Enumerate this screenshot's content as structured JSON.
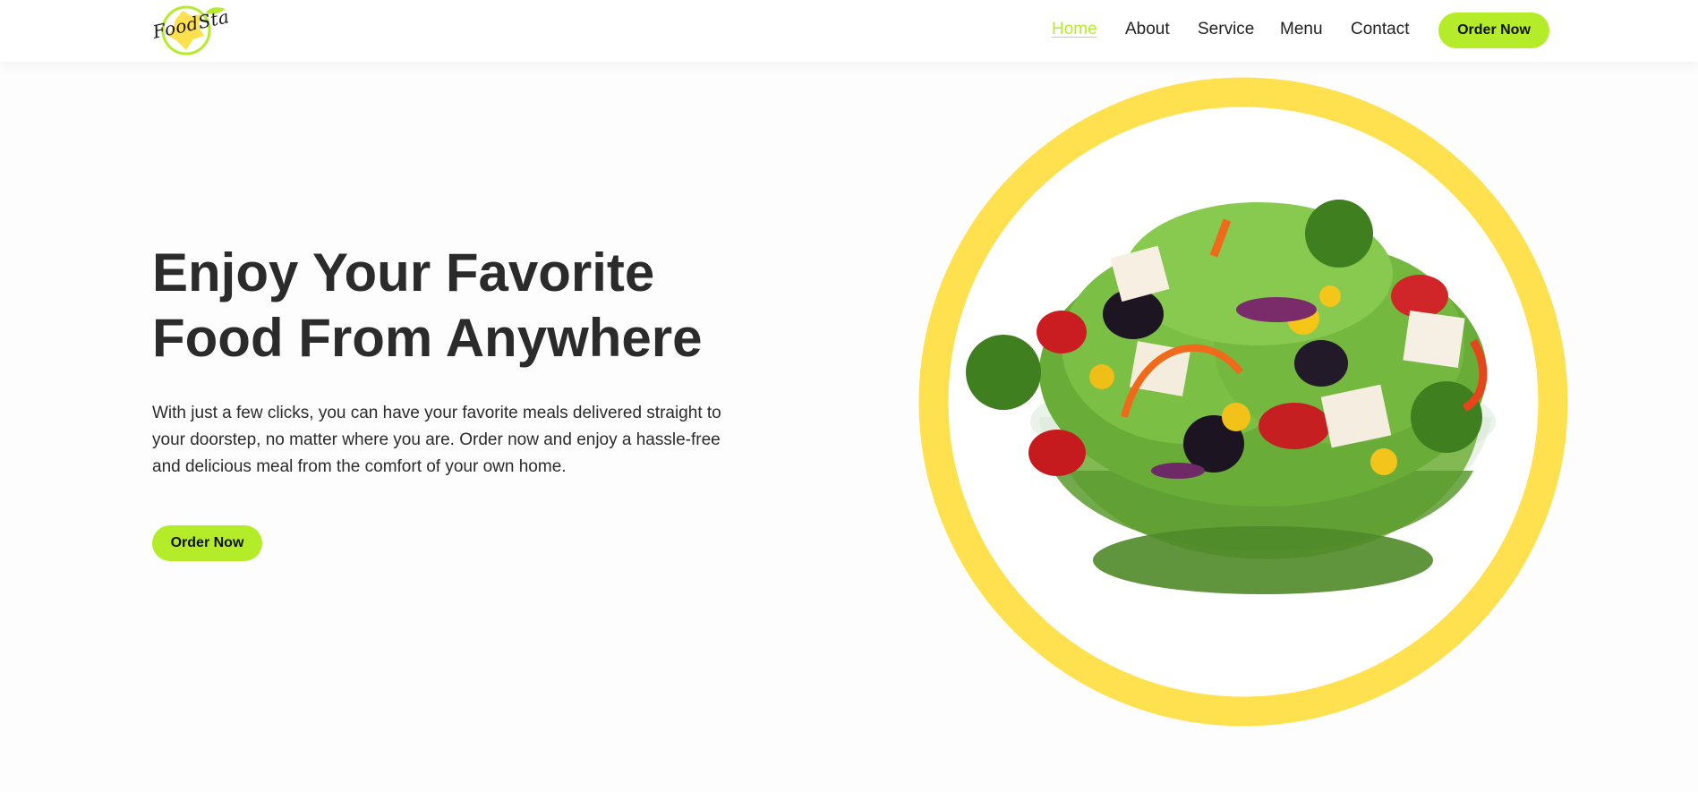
{
  "brand": {
    "logo_text": "FoodSta",
    "accent_color": "#b5ec2a",
    "ring_color": "#ffe14f"
  },
  "nav": {
    "items": [
      {
        "label": "Home",
        "active": true
      },
      {
        "label": "About",
        "active": false
      },
      {
        "label": "Service",
        "active": false
      },
      {
        "label": "Menu",
        "active": false
      },
      {
        "label": "Contact",
        "active": false
      }
    ],
    "order_label": "Order Now"
  },
  "hero": {
    "title_line1": "Enjoy Your Favorite",
    "title_line2": "Food From Anywhere",
    "description": "With just a few clicks, you can have your favorite meals delivered straight to your doorstep, no matter where you are. Order now and enjoy a hassle-free and delicious meal from the comfort of your own home.",
    "order_label": "Order Now",
    "image": "salad-bowl-image"
  }
}
